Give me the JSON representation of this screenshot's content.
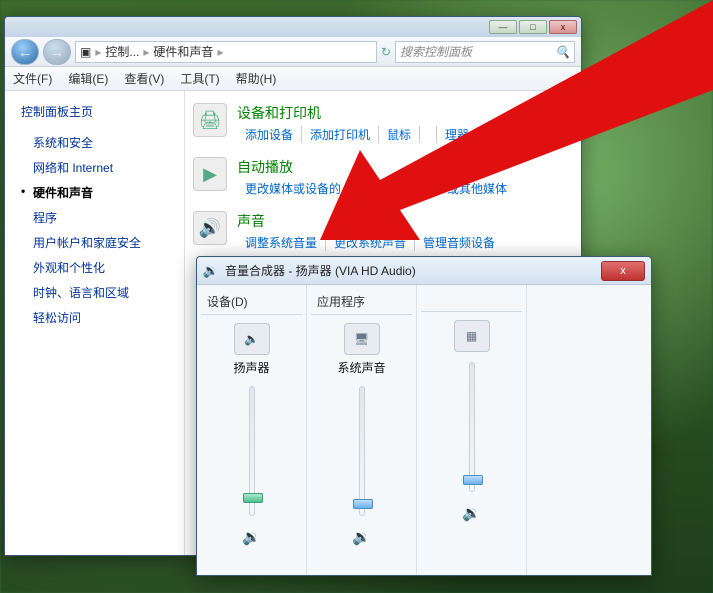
{
  "cp": {
    "titlebar": {
      "min": "—",
      "max": "□",
      "close": "x"
    },
    "nav": {
      "back": "←",
      "fwd": "→",
      "bc1": "控制...",
      "bc2": "硬件和声音",
      "search_ph": "搜索控制面板"
    },
    "menu": {
      "file": "文件(F)",
      "edit": "编辑(E)",
      "view": "查看(V)",
      "tools": "工具(T)",
      "help": "帮助(H)"
    },
    "sidebar": {
      "home": "控制面板主页",
      "items": [
        "系统和安全",
        "网络和 Internet",
        "硬件和声音",
        "程序",
        "用户帐户和家庭安全",
        "外观和个性化",
        "时钟、语言和区域",
        "轻松访问"
      ]
    },
    "cats": {
      "devices": {
        "title": "设备和打印机",
        "links": [
          "添加设备",
          "添加打印机",
          "鼠标",
          "",
          "理器"
        ]
      },
      "autoplay": {
        "title": "自动播放",
        "links": [
          "更改媒体或设备的",
          "",
          "自动播放 CD 或其他媒体"
        ]
      },
      "sound": {
        "title": "声音",
        "links": [
          "调整系统音量",
          "更改系统声音",
          "管理音频设备"
        ]
      }
    }
  },
  "vm": {
    "title": "音量合成器 - 扬声器 (VIA HD Audio)",
    "close": "x",
    "device_hdr": "设备(D)",
    "app_hdr": "应用程序",
    "cols": [
      {
        "label": "扬声器",
        "thumb": "master"
      },
      {
        "label": "系统声音",
        "thumb": "app"
      },
      {
        "label": "",
        "thumb": "app"
      }
    ],
    "speaker_icon": "🔉"
  }
}
